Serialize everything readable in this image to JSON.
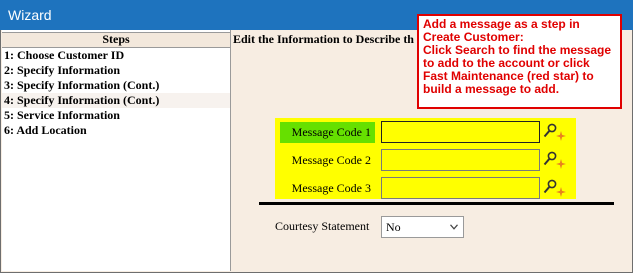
{
  "window": {
    "title": "Wizard"
  },
  "steps": {
    "header": "Steps",
    "items": [
      {
        "label": "1: Choose Customer ID"
      },
      {
        "label": "2: Specify Information"
      },
      {
        "label": "3: Specify Information (Cont.)"
      },
      {
        "label": "4: Specify Information (Cont.)"
      },
      {
        "label": "5: Service Information"
      },
      {
        "label": "6: Add Location"
      }
    ],
    "selected_index": 3
  },
  "content": {
    "title": "Edit the Information to Describe th"
  },
  "callout": {
    "text": "Add a message as a step in Create Customer:\nClick Search to find the message to add to the account or click Fast Maintenance (red star) to build a message to add."
  },
  "message_codes": [
    {
      "label": "Message Code 1",
      "value": "",
      "highlighted": true,
      "focused": true
    },
    {
      "label": "Message Code 2",
      "value": "",
      "highlighted": false,
      "focused": false
    },
    {
      "label": "Message Code 3",
      "value": "",
      "highlighted": false,
      "focused": false
    }
  ],
  "courtesy": {
    "label": "Courtesy Statement",
    "value": "No"
  },
  "icons": {
    "search": "magnifier-icon",
    "fast_maintenance": "red-star-icon"
  },
  "colors": {
    "titlebar": "#1e73be",
    "highlight_box": "#ffff00",
    "label_highlight": "#66e000",
    "callout": "#e00000"
  }
}
